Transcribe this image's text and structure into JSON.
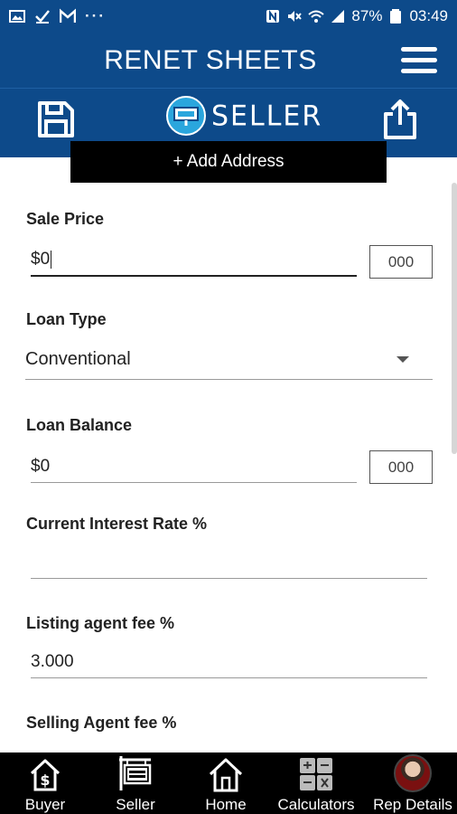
{
  "status_bar": {
    "battery": "87%",
    "time": "03:49",
    "overflow": "···",
    "left_icons": [
      "image-icon",
      "check-icon",
      "gmail-icon"
    ],
    "right_icons": [
      "nfc-icon",
      "mute-icon",
      "wifi-icon",
      "signal-icon",
      "battery-icon"
    ]
  },
  "header": {
    "title": "RENET SHEETS",
    "menu_icon": "hamburger-icon"
  },
  "toolbar": {
    "save_icon": "save-icon",
    "logo_text": "SELLER",
    "share_icon": "share-icon",
    "add_address_label": "+ Add Address"
  },
  "form": {
    "sale_price": {
      "label": "Sale Price",
      "value": "$0",
      "zeros_button": "000"
    },
    "loan_type": {
      "label": "Loan Type",
      "selected": "Conventional"
    },
    "loan_balance": {
      "label": "Loan Balance",
      "value": "$0",
      "zeros_button": "000"
    },
    "interest_rate": {
      "label": "Current Interest Rate %",
      "value": ""
    },
    "listing_fee": {
      "label": "Listing agent fee %",
      "value": "3.000"
    },
    "selling_fee": {
      "label": "Selling Agent fee %"
    }
  },
  "bottom_nav": [
    {
      "label": "Buyer",
      "icon": "buyer-house-dollar-icon"
    },
    {
      "label": "Seller",
      "icon": "for-rent-sign-icon"
    },
    {
      "label": "Home",
      "icon": "home-icon"
    },
    {
      "label": "Calculators",
      "icon": "calculator-icon"
    },
    {
      "label": "Rep Details",
      "icon": "avatar"
    }
  ],
  "colors": {
    "header_bg": "#0d4a8a",
    "nav_bg": "#000000",
    "accent": "#2aa6dd"
  }
}
